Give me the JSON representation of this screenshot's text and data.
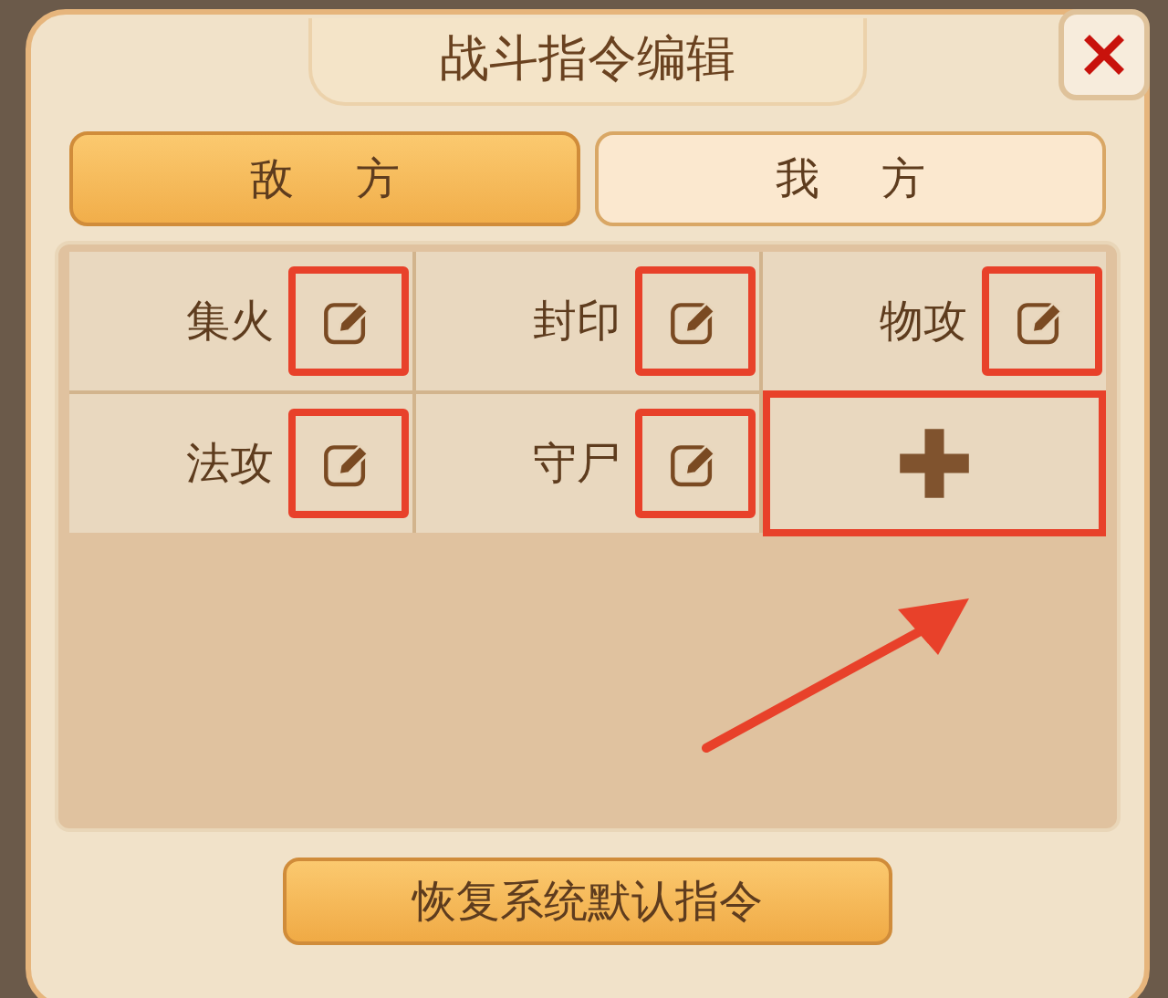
{
  "window": {
    "title": "战斗指令编辑"
  },
  "tabs": [
    {
      "label": "敌 方",
      "selected": true
    },
    {
      "label": "我 方",
      "selected": false
    }
  ],
  "commands": [
    {
      "kind": "command",
      "label": "集火",
      "highlighted": true
    },
    {
      "kind": "command",
      "label": "封印",
      "highlighted": true
    },
    {
      "kind": "command",
      "label": "物攻",
      "highlighted": true
    },
    {
      "kind": "command",
      "label": "法攻",
      "highlighted": true
    },
    {
      "kind": "command",
      "label": "守尸",
      "highlighted": true
    },
    {
      "kind": "add",
      "highlighted": true
    }
  ],
  "annotation_arrow": {
    "shown": true
  },
  "buttons": [
    "恢复系统默认指令"
  ]
}
